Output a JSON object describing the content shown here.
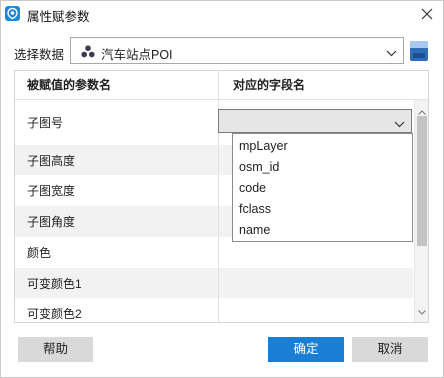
{
  "window": {
    "title": "属性赋参数",
    "icon": "app-logo-icon",
    "close_icon": "close-icon"
  },
  "datasource": {
    "label": "选择数据",
    "selected": "汽车站点POI",
    "selected_icon": "point-layer-icon",
    "database_icon": "database-icon"
  },
  "grid": {
    "columns": [
      "被赋值的参数名",
      "对应的字段名"
    ],
    "rows": [
      {
        "param": "子图号",
        "field": ""
      },
      {
        "param": "子图高度",
        "field": ""
      },
      {
        "param": "子图宽度",
        "field": ""
      },
      {
        "param": "子图角度",
        "field": ""
      },
      {
        "param": "颜色",
        "field": ""
      },
      {
        "param": "可变颜色1",
        "field": ""
      },
      {
        "param": "可变颜色2",
        "field": ""
      }
    ]
  },
  "field_dropdown": {
    "current_value": "",
    "options": [
      "mpLayer",
      "osm_id",
      "code",
      "fclass",
      "name"
    ]
  },
  "buttons": {
    "help": "帮助",
    "ok": "确定",
    "cancel": "取消"
  },
  "colors": {
    "accent": "#1a7fd4",
    "alt_row": "#f2f2f2",
    "neutral_button": "#d9d9d9"
  }
}
